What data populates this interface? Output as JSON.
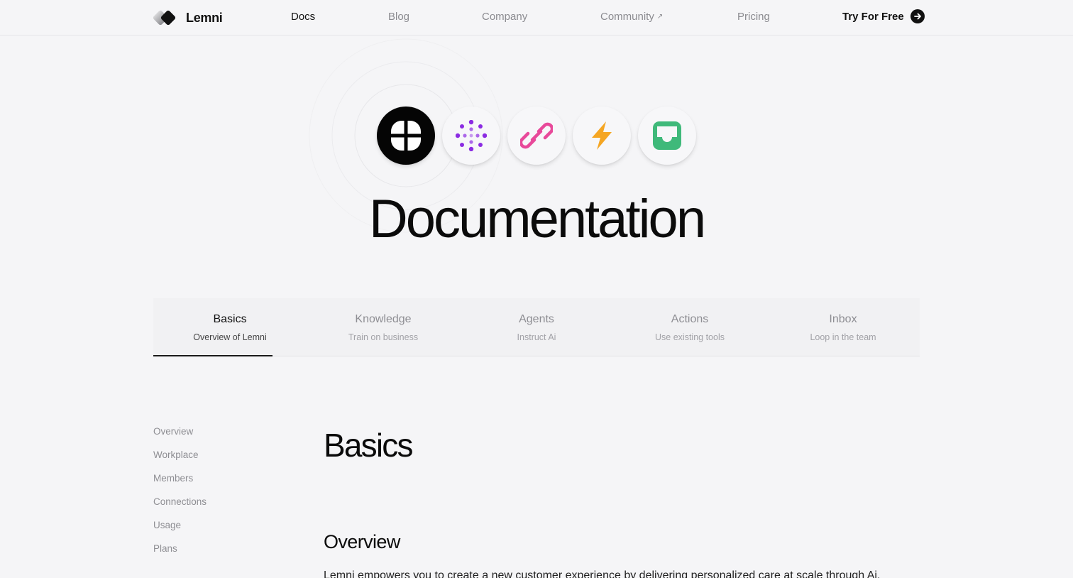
{
  "nav": {
    "brand": "Lemni",
    "links": [
      {
        "label": "Docs",
        "active": true
      },
      {
        "label": "Blog"
      },
      {
        "label": "Company"
      },
      {
        "label": "Community",
        "external": true
      },
      {
        "label": "Pricing"
      }
    ],
    "external_marker": "↗",
    "cta": "Try For Free"
  },
  "hero": {
    "title": "Documentation",
    "icons": [
      "grid-icon",
      "dots-icon",
      "link-icon",
      "bolt-icon",
      "inbox-icon"
    ],
    "colors": {
      "dots": "#8b2be2",
      "link": "#e8499a",
      "bolt": "#f5a623",
      "inbox": "#3fb97a"
    }
  },
  "tabs": [
    {
      "title": "Basics",
      "subtitle": "Overview of Lemni",
      "active": true
    },
    {
      "title": "Knowledge",
      "subtitle": "Train on business"
    },
    {
      "title": "Agents",
      "subtitle": "Instruct Ai"
    },
    {
      "title": "Actions",
      "subtitle": "Use existing tools"
    },
    {
      "title": "Inbox",
      "subtitle": "Loop in the team"
    }
  ],
  "sidebar": {
    "items": [
      "Overview",
      "Workplace",
      "Members",
      "Connections",
      "Usage",
      "Plans"
    ]
  },
  "content": {
    "heading": "Basics",
    "section_heading": "Overview",
    "paragraph": "Lemni empowers you to create a new customer experience by delivering personalized care at scale through Ai."
  }
}
